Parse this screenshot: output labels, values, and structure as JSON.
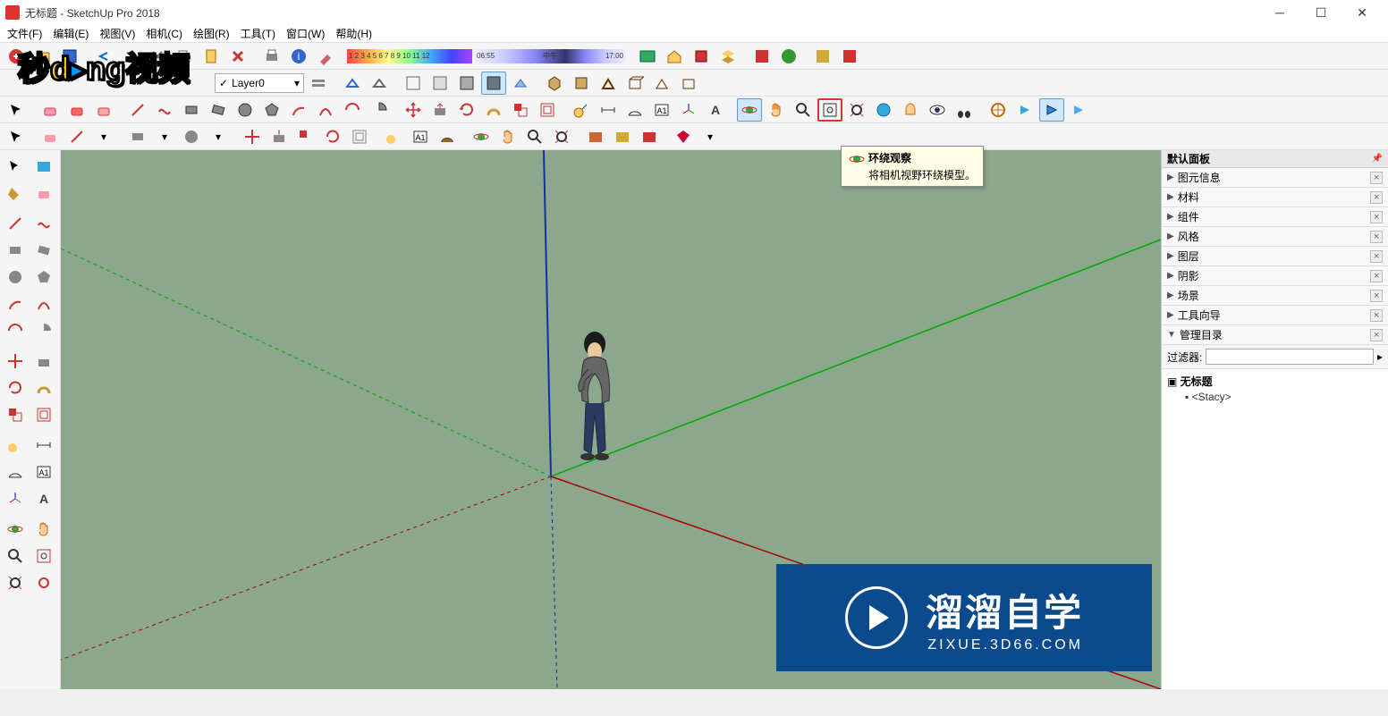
{
  "titlebar": {
    "title": "无标题 - SketchUp Pro 2018"
  },
  "menubar": {
    "items": [
      "文件(F)",
      "编辑(E)",
      "视图(V)",
      "相机(C)",
      "绘图(R)",
      "工具(T)",
      "窗口(W)",
      "帮助(H)"
    ]
  },
  "layer": {
    "current": "Layer0"
  },
  "timebar": {
    "left": "06:55",
    "mid": "中午",
    "right": "17:00"
  },
  "tooltip": {
    "title": "环绕观察",
    "desc": "将相机视野环绕模型。"
  },
  "panels": {
    "header": "默认面板",
    "sections": [
      "图元信息",
      "材料",
      "组件",
      "风格",
      "图层",
      "阴影",
      "场景",
      "工具向导",
      "管理目录"
    ],
    "filter_label": "过滤器:"
  },
  "outliner": {
    "root": "无标题",
    "child": "<Stacy>"
  },
  "watermark": {
    "main": "溜溜自学",
    "sub": "ZIXUE.3D66.COM"
  },
  "brand_overlay": "秒dòng视频",
  "gradient_numbers": "1 2 3 4 5 6 7 8 9 10 11 12"
}
